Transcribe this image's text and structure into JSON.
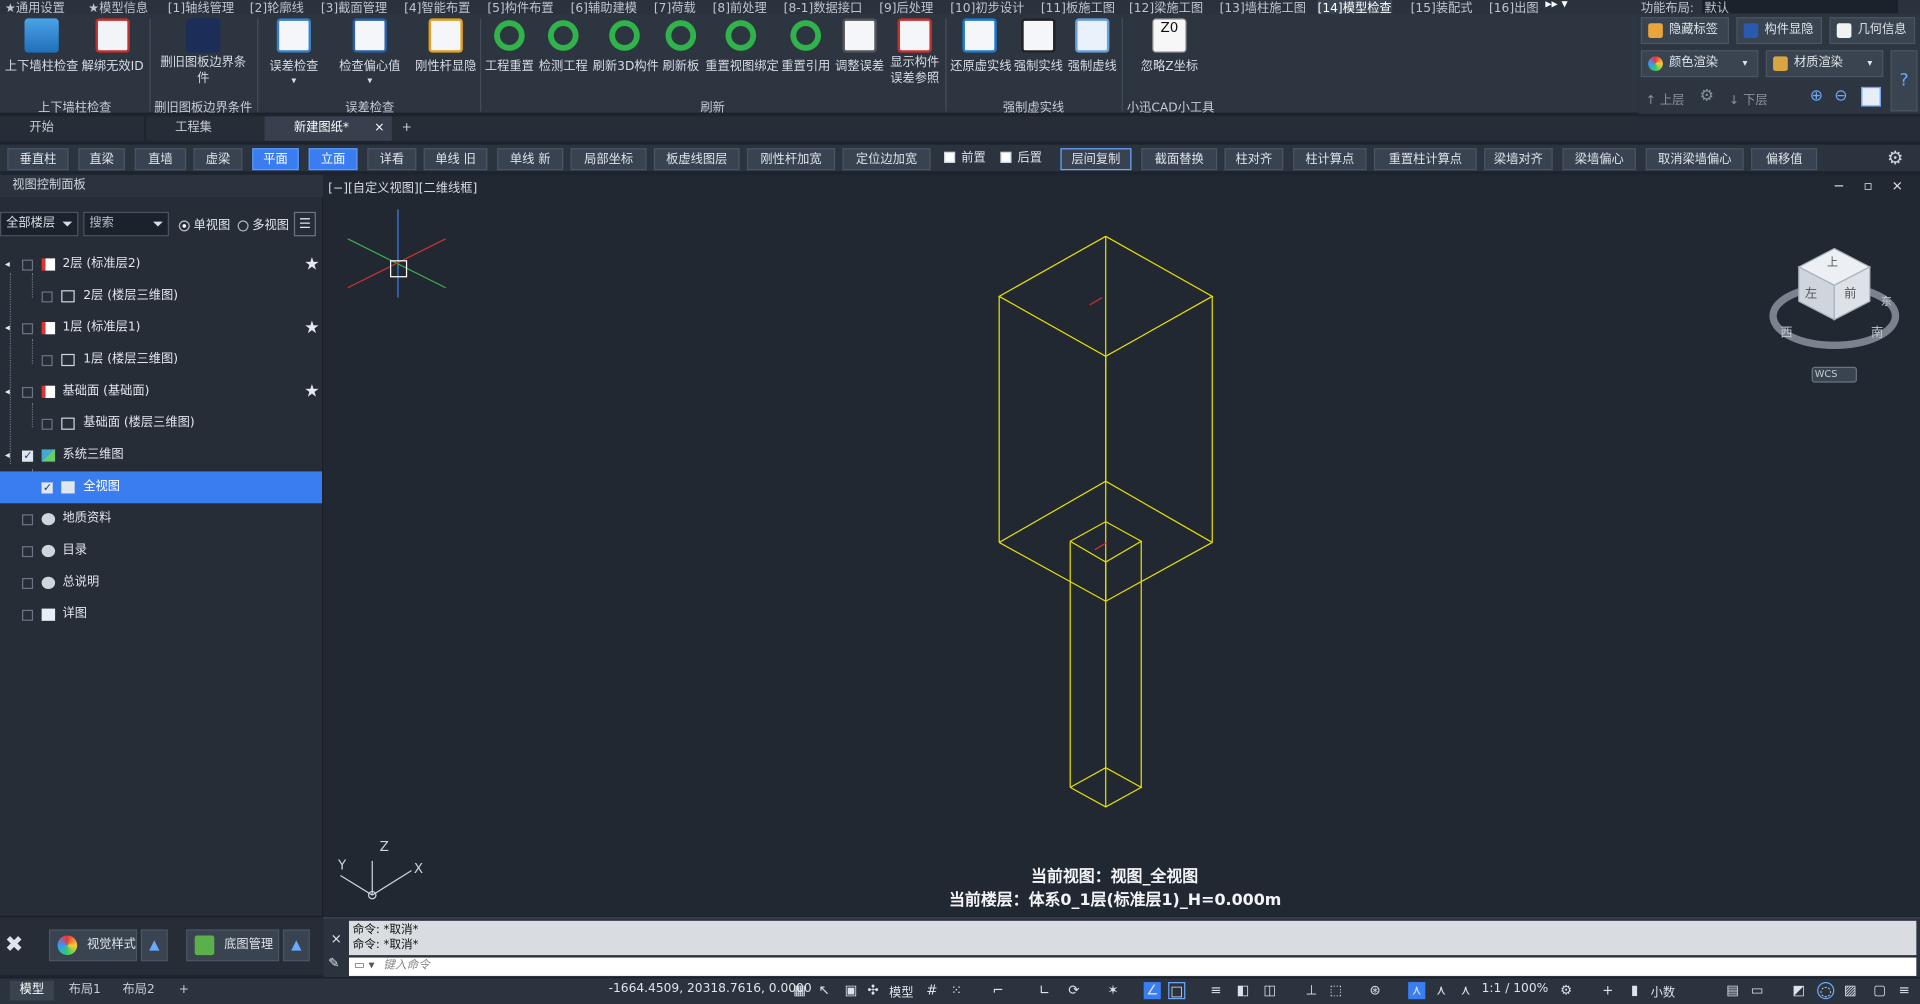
{
  "menubar": {
    "items": [
      "★通用设置",
      "★模型信息",
      "[1]轴线管理",
      "[2]轮廓线",
      "[3]截面管理",
      "[4]智能布置",
      "[5]构件布置",
      "[6]辅助建模",
      "[7]荷载",
      "[8]前处理",
      "[8-1]数据接口",
      "[9]后处理",
      "[10]初步设计",
      "[11]板施工图",
      "[12]梁施工图",
      "[13]墙柱施工图",
      "[14]模型检查",
      "[15]装配式",
      "[16]出图"
    ],
    "layout_label": "功能布局:",
    "layout_value": "默认"
  },
  "ribbon": {
    "buttons": [
      "上下墙柱检查",
      "解绑无效ID",
      "删旧图板边界条件",
      "误差检查",
      "检查偏心值",
      "刚性杆显隐",
      "工程重置",
      "检测工程",
      "刷新3D构件",
      "刷新板",
      "重置视图绑定",
      "重置引用",
      "调整误差",
      "显示构件误差参照",
      "还原虚实线",
      "强制实线",
      "强制虚线",
      "忽略Z坐标"
    ],
    "groups": [
      "上下墙柱检查",
      "删旧图板边界条件",
      "误差检查",
      "刷新",
      "强制虚实线",
      "小迅CAD小工具"
    ],
    "z_icon": "Z0"
  },
  "rpanel": {
    "hide_label": "隐藏标签",
    "component_toggle": "构件显隐",
    "geometry_info": "几何信息",
    "color_render": "颜色渲染",
    "material_render": "材质渲染",
    "up_floor": "上层",
    "down_floor": "下层",
    "help": "?"
  },
  "tabs": [
    "开始",
    "工程集",
    "新建图纸*"
  ],
  "toolbar": {
    "buttons": [
      "垂直柱",
      "直梁",
      "直墙",
      "虚梁",
      "平面",
      "立面",
      "详看",
      "单线 旧",
      "单线 新",
      "局部坐标",
      "板虚线图层",
      "刚性杆加宽",
      "定位边加宽",
      "前置",
      "后置",
      "层间复制",
      "截面替换",
      "柱对齐",
      "柱计算点",
      "重置柱计算点",
      "梁墙对齐",
      "梁墙偏心",
      "取消梁墙偏心",
      "偏移值"
    ]
  },
  "left_panel": {
    "title": "视图控制面板",
    "floor_select": "全部楼层",
    "search_placeholder": "搜索",
    "single_view": "单视图",
    "multi_view": "多视图",
    "tree": [
      {
        "label": "2层  (标准层2)",
        "star": "★"
      },
      {
        "label": "2层  (楼层三维图)"
      },
      {
        "label": "1层  (标准层1)",
        "star": "★"
      },
      {
        "label": "1层  (楼层三维图)"
      },
      {
        "label": "基础面  (基础面)",
        "star": "★"
      },
      {
        "label": "基础面  (楼层三维图)"
      },
      {
        "label": "系统三维图"
      },
      {
        "label": "全视图"
      },
      {
        "label": "地质资料"
      },
      {
        "label": "目录"
      },
      {
        "label": "总说明"
      },
      {
        "label": "详图"
      }
    ],
    "visual_style": "视觉样式",
    "base_map": "底图管理"
  },
  "viewport": {
    "title": "[−][自定义视图][二维线框]",
    "controls": "− ▫ ×",
    "current_view": "当前视图：视图_全视图",
    "current_floor": "当前楼层：体系0_1层(标准层1)_H=0.000m",
    "viewcube": {
      "top": "上",
      "front": "前",
      "left": "左",
      "west": "西",
      "south": "南",
      "east": "东",
      "wcs": "WCS"
    },
    "ucs": {
      "x": "X",
      "y": "Y",
      "z": "Z"
    }
  },
  "command": {
    "history": [
      "命令: *取消*",
      "命令: *取消*"
    ],
    "placeholder": "键入命令"
  },
  "status": {
    "tabs": [
      "模型",
      "布局1",
      "布局2"
    ],
    "coords": "-1664.4509, 20318.7616, 0.0000",
    "model_label": "模型",
    "scale": "1:1 / 100%",
    "decimal": "小数"
  },
  "colors": {
    "accent": "#3a7df0",
    "wire": "#e8e000",
    "bg": "#212832"
  }
}
